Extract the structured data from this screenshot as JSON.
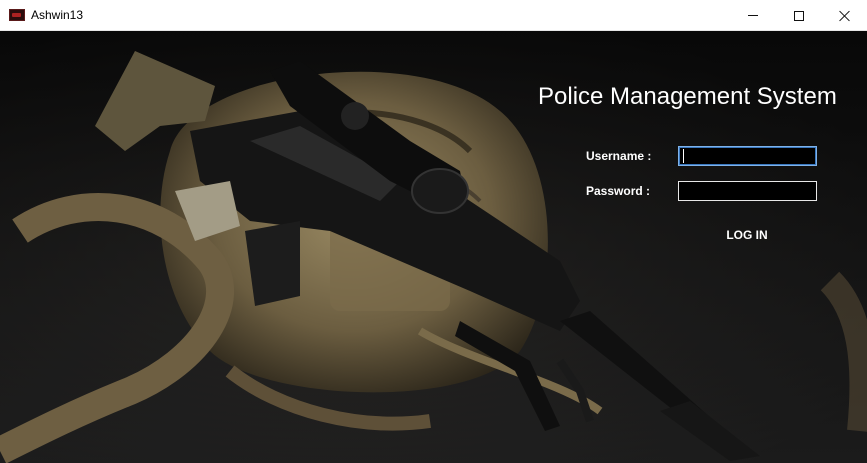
{
  "window": {
    "title": "Ashwin13",
    "icon": "app-icon",
    "controls": {
      "minimize": "minimize-icon",
      "maximize": "maximize-icon",
      "close": "close-icon"
    }
  },
  "form": {
    "heading": "Police Management System",
    "username_label": "Username :",
    "username_value": "",
    "password_label": "Password :",
    "password_value": "",
    "login_label": "LOG IN"
  },
  "colors": {
    "background": "#000000",
    "text": "#ffffff",
    "focus_border": "#7fb2e8"
  }
}
